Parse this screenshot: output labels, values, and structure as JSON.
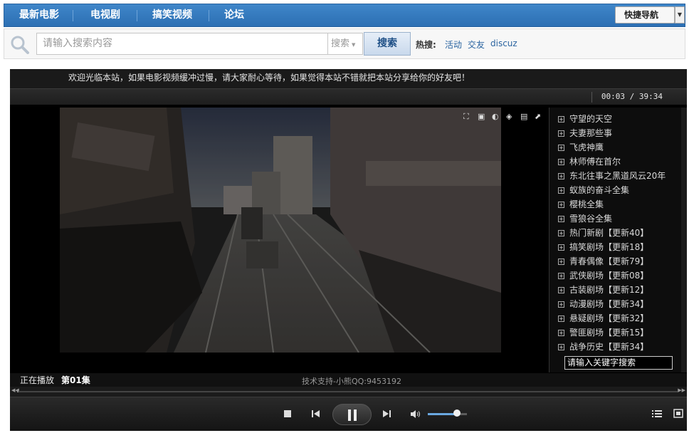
{
  "nav": {
    "items": [
      "最新电影",
      "电视剧",
      "搞笑视频",
      "论坛"
    ],
    "quick_nav": "快捷导航"
  },
  "search": {
    "placeholder": "请输入搜索内容",
    "scope": "搜索",
    "button": "搜索",
    "hot_label": "热搜:",
    "hot_links": [
      "活动",
      "交友",
      "discuz"
    ]
  },
  "player": {
    "notice": "欢迎光临本站，如果电影视频缓冲过慢，请大家耐心等待，如果觉得本站不错就把本站分享给你的好友吧！",
    "time": "00:03 / 39:34",
    "now_playing_label": "正在播放",
    "episode": "第01集",
    "support": "技术支持-小熊QQ:9453192",
    "progress": 0.002,
    "volume": 0.75,
    "playlist": [
      "守望的天空",
      "夫妻那些事",
      "飞虎神鹰",
      "林师傅在首尔",
      "东北往事之黑道风云20年",
      "蚁族的奋斗全集",
      "樱桃全集",
      "雪狼谷全集",
      "热门新剧【更新40】",
      "搞笑剧场【更新18】",
      "青春偶像【更新79】",
      "武侠剧场【更新08】",
      "古装剧场【更新12】",
      "动漫剧场【更新34】",
      "悬疑剧场【更新32】",
      "警匪剧场【更新15】",
      "战争历史【更新34】"
    ],
    "playlist_search_placeholder": "请输入关键字搜索"
  },
  "colors": {
    "nav_bg": "#2c6fb3",
    "player_bg": "#000000",
    "link": "#2a64a0"
  }
}
